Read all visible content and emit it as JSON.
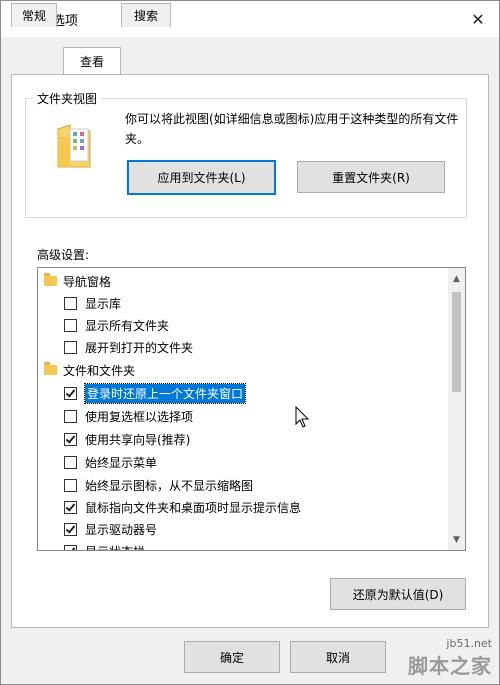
{
  "window": {
    "title": "文件夹选项",
    "close_glyph": "✕"
  },
  "tabs": [
    {
      "label": "常规",
      "active": false
    },
    {
      "label": "查看",
      "active": true
    },
    {
      "label": "搜索",
      "active": false
    }
  ],
  "folder_views": {
    "title": "文件夹视图",
    "description": "你可以将此视图(如详细信息或图标)应用于这种类型的所有文件夹。",
    "apply_button": "应用到文件夹(L)",
    "reset_button": "重置文件夹(R)"
  },
  "advanced": {
    "label": "高级设置:",
    "items": [
      {
        "type": "folder",
        "label": "导航窗格"
      },
      {
        "type": "checkbox",
        "label": "显示库",
        "checked": false
      },
      {
        "type": "checkbox",
        "label": "显示所有文件夹",
        "checked": false
      },
      {
        "type": "checkbox",
        "label": "展开到打开的文件夹",
        "checked": false
      },
      {
        "type": "folder",
        "label": "文件和文件夹"
      },
      {
        "type": "checkbox",
        "label": "登录时还原上一个文件夹窗口",
        "checked": true,
        "selected": true
      },
      {
        "type": "checkbox",
        "label": "使用复选框以选择项",
        "checked": false
      },
      {
        "type": "checkbox",
        "label": "使用共享向导(推荐)",
        "checked": true
      },
      {
        "type": "checkbox",
        "label": "始终显示菜单",
        "checked": false
      },
      {
        "type": "checkbox",
        "label": "始终显示图标，从不显示缩略图",
        "checked": false
      },
      {
        "type": "checkbox",
        "label": "鼠标指向文件夹和桌面项时显示提示信息",
        "checked": true
      },
      {
        "type": "checkbox",
        "label": "显示驱动器号",
        "checked": true
      },
      {
        "type": "checkbox",
        "label": "显示状态栏",
        "checked": true
      }
    ],
    "restore_button": "还原为默认值(D)"
  },
  "footer": {
    "ok_button": "确定",
    "cancel_button": "取消"
  },
  "watermark": {
    "url": "jb51.net",
    "name": "脚本之家"
  }
}
